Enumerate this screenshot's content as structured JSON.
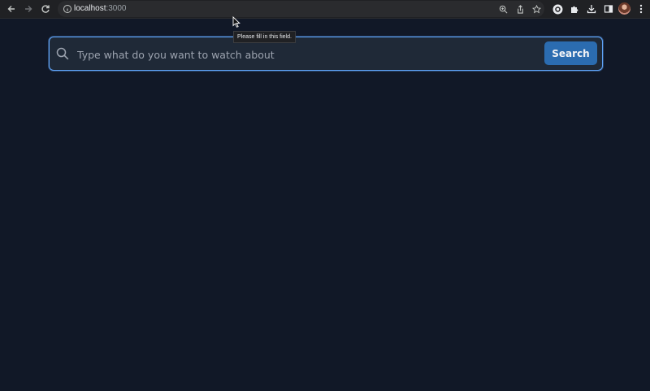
{
  "browser": {
    "url_host": "localhost",
    "url_port": ":3000",
    "toolbar_icons": [
      "back-arrow-icon",
      "forward-arrow-icon",
      "reload-icon",
      "zoom-icon",
      "share-icon",
      "bookmark-star-icon",
      "extension-app-icon",
      "puzzle-icon",
      "download-icon",
      "sidepanel-icon",
      "kebab-menu-icon"
    ]
  },
  "tooltip": {
    "text": "Please fill in this field."
  },
  "search": {
    "placeholder": "Type what do you want to watch about",
    "value": "",
    "button_label": "Search"
  },
  "colors": {
    "page_background": "#111827",
    "search_field": "#1f2937",
    "focus_border": "#60a5fa",
    "button": "#2b6cb0"
  }
}
